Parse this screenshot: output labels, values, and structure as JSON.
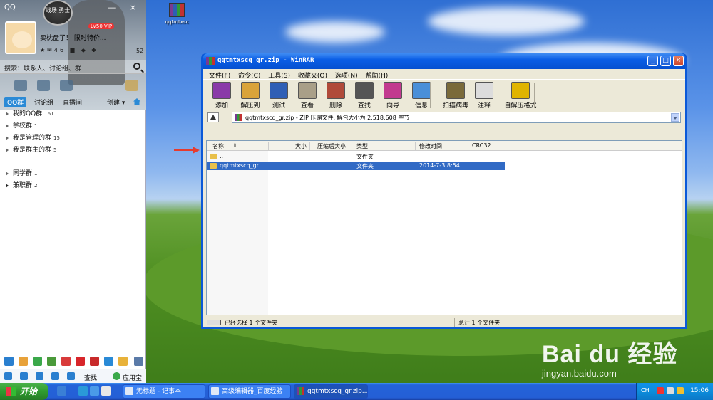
{
  "desktop": {
    "icon_label": "qqtmtxsc"
  },
  "qq": {
    "title": "QQ",
    "badge": "战场\n勇士",
    "status": "卖枕盘了！ 限时特价...",
    "vip_label": "LV50 VIP",
    "stats_left": "46",
    "stats_right": "52",
    "search_placeholder": "搜索：联系人、讨论组、群",
    "tabs": [
      {
        "label": "QQ群"
      },
      {
        "label": "讨论组"
      },
      {
        "label": "直播间"
      },
      {
        "label": "创建 ▾"
      }
    ],
    "groups": [
      {
        "label": "我的QQ群",
        "count": "161"
      },
      {
        "label": "学校群",
        "count": "1"
      },
      {
        "label": "我是管理的群",
        "count": "15"
      },
      {
        "label": "我是群主的群",
        "count": "5"
      },
      {
        "label": "同学群",
        "count": "1"
      },
      {
        "label": "兼职群",
        "count": "2"
      }
    ],
    "bottom": {
      "find": "查找",
      "apps": "应用宝"
    }
  },
  "winrar": {
    "title": "qqtmtxscq_gr.zip - WinRAR",
    "menu": [
      "文件(F)",
      "命令(C)",
      "工具(S)",
      "收藏夹(O)",
      "选项(N)",
      "帮助(H)"
    ],
    "tools": [
      {
        "label": "添加",
        "icon": "add-icon",
        "color": "#8a3aa8"
      },
      {
        "label": "解压到",
        "icon": "extract-icon",
        "color": "#d9a33a"
      },
      {
        "label": "测试",
        "icon": "test-icon",
        "color": "#2f5fb5"
      },
      {
        "label": "查看",
        "icon": "view-icon",
        "color": "#a99f88"
      },
      {
        "label": "删除",
        "icon": "delete-icon",
        "color": "#b04a3a"
      },
      {
        "label": "查找",
        "icon": "find-icon",
        "color": "#555555"
      },
      {
        "label": "向导",
        "icon": "wizard-icon",
        "color": "#c23a8f"
      },
      {
        "label": "信息",
        "icon": "info-icon",
        "color": "#4a8fd8"
      },
      {
        "label": "扫描病毒",
        "icon": "scan-icon",
        "color": "#7a6a3a"
      },
      {
        "label": "注释",
        "icon": "comment-icon",
        "color": "#dcdcdc"
      },
      {
        "label": "自解压格式",
        "icon": "sfx-icon",
        "color": "#e0b400"
      }
    ],
    "address": "qqtmtxscq_gr.zip - ZIP 压缩文件, 解包大小为 2,518,608 字节",
    "columns": [
      "名称",
      "大小",
      "压缩后大小",
      "类型",
      "修改时间",
      "CRC32"
    ],
    "rows": [
      {
        "name": "..",
        "size": "",
        "packed": "",
        "type": "文件夹",
        "modified": "",
        "crc": ""
      },
      {
        "name": "qqtmtxscq_gr",
        "size": "",
        "packed": "",
        "type": "文件夹",
        "modified": "2014-7-3 8:54",
        "crc": ""
      }
    ],
    "status_left": "已经选择 1 个文件夹",
    "status_right": "总计 1 个文件夹"
  },
  "watermark": {
    "main": "Bai du 经验",
    "url": "jingyan.baidu.com"
  },
  "taskbar": {
    "start": "开始",
    "tasks": [
      {
        "label": "无标题 - 记事本"
      },
      {
        "label": "高级编辑器_百度经验"
      },
      {
        "label": "qqtmtxscq_gr.zip..."
      }
    ],
    "tray_lang": "CH",
    "clock": "15:06"
  }
}
